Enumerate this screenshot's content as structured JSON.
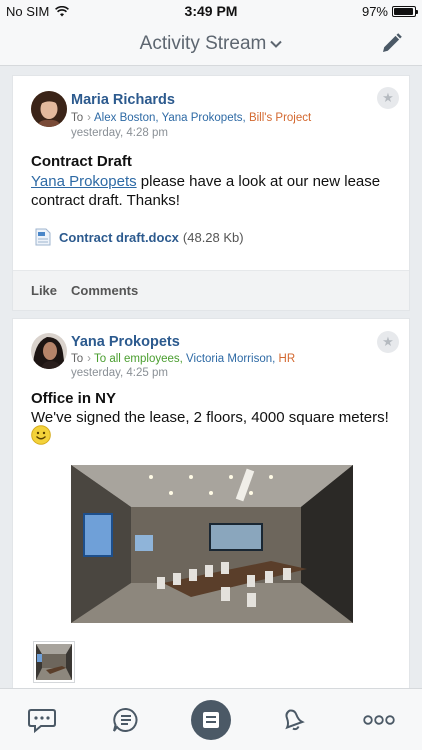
{
  "status_bar": {
    "carrier": "No SIM",
    "time": "3:49 PM",
    "battery": "97%",
    "battery_level": 0.97
  },
  "nav": {
    "title": "Activity Stream"
  },
  "posts": [
    {
      "author": "Maria Richards",
      "to_prefix": "To",
      "recipients": [
        {
          "text": "Alex Boston, ",
          "color": "blue"
        },
        {
          "text": "Yana Prokopets, ",
          "color": "blue"
        },
        {
          "text": "Bill's Project",
          "color": "orange"
        }
      ],
      "time": "yesterday, 4:28 pm",
      "title": "Contract Draft",
      "mention": "Yana Prokopets",
      "body": " please have a look at our new lease contract draft. Thanks!",
      "attachment": {
        "name": "Contract draft.docx",
        "size": "(48.28 Kb)"
      },
      "actions": {
        "like": "Like",
        "comments": "Comments"
      }
    },
    {
      "author": "Yana Prokopets",
      "to_prefix": "To",
      "recipients": [
        {
          "text": "To all employees, ",
          "color": "green"
        },
        {
          "text": "Victoria Morrison, ",
          "color": "blue"
        },
        {
          "text": "HR",
          "color": "orange"
        }
      ],
      "time": "yesterday, 4:25 pm",
      "title": "Office in NY",
      "body": "We've signed the lease, 2 floors, 4000 square meters!"
    }
  ],
  "icons": {
    "wifi": "wifi-icon",
    "compose": "pencil-icon",
    "star": "star-icon",
    "tab_chat": "chat-bubble-icon",
    "tab_feed": "feed-list-icon",
    "tab_stream": "activity-stream-icon",
    "tab_notifications": "bell-icon",
    "tab_more": "more-dots-icon"
  },
  "colors": {
    "accent_blue": "#2c5a8e",
    "orange": "#d3682f",
    "green": "#4a9e2f",
    "tab_active": "#4b5966"
  }
}
